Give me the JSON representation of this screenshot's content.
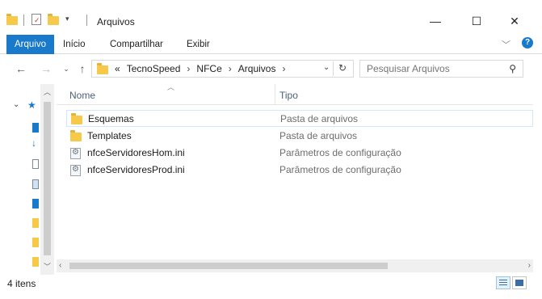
{
  "window": {
    "title": "Arquivos",
    "controls": {
      "minimize": "—",
      "maximize": "☐",
      "close": "✕"
    }
  },
  "ribbon": {
    "tabs": [
      {
        "label": "Arquivo"
      },
      {
        "label": "Início"
      },
      {
        "label": "Compartilhar"
      },
      {
        "label": "Exibir"
      }
    ]
  },
  "address": {
    "overflow": "«",
    "crumbs": [
      "TecnoSpeed",
      "NFCe",
      "Arquivos"
    ],
    "separator": "›"
  },
  "search": {
    "placeholder": "Pesquisar Arquivos"
  },
  "columns": {
    "name": "Nome",
    "type": "Tipo"
  },
  "files": [
    {
      "name": "Esquemas",
      "type": "Pasta de arquivos",
      "icon": "folder-icon"
    },
    {
      "name": "Templates",
      "type": "Pasta de arquivos",
      "icon": "folder-icon"
    },
    {
      "name": "nfceServidoresHom.ini",
      "type": "Parâmetros de configuração",
      "icon": "config-file-icon"
    },
    {
      "name": "nfceServidoresProd.ini",
      "type": "Parâmetros de configuração",
      "icon": "config-file-icon"
    }
  ],
  "status": {
    "item_count": "4 itens"
  },
  "colors": {
    "accent": "#1979ca",
    "folder": "#f6c94a",
    "header_text": "#4c607a"
  }
}
